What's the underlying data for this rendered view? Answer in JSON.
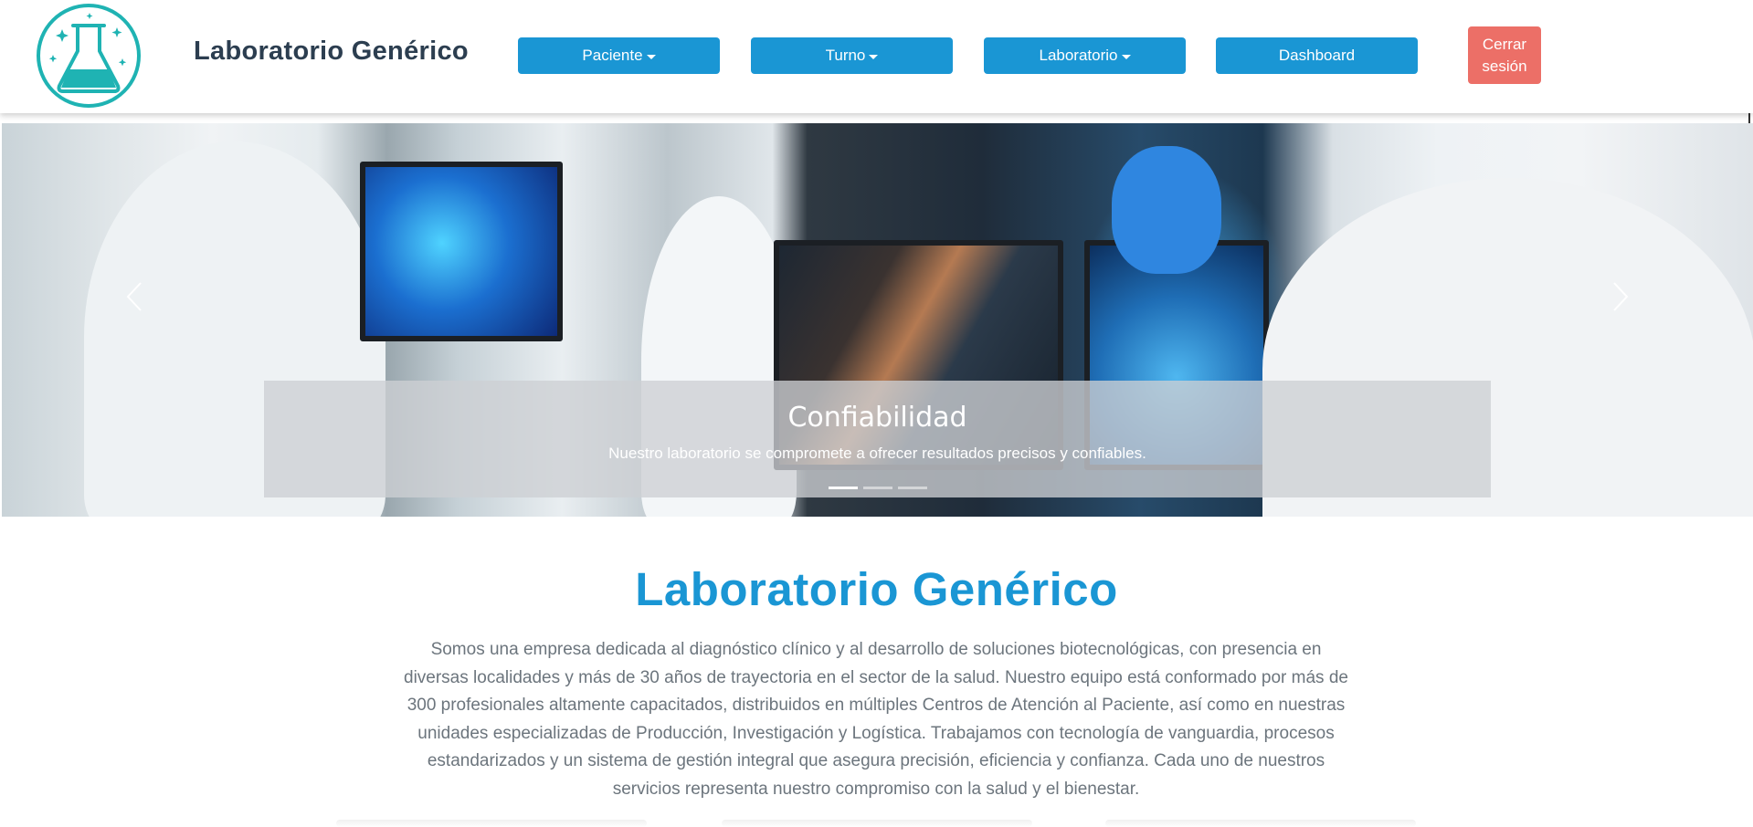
{
  "header": {
    "brand": "Laboratorio Genérico",
    "logo_icon": "flask-icon",
    "nav": {
      "paciente": "Paciente",
      "turno": "Turno",
      "laboratorio": "Laboratorio",
      "dashboard": "Dashboard"
    },
    "logout_label": "Cerrar sesión"
  },
  "carousel": {
    "caption_title": "Confiabilidad",
    "caption_text": "Nuestro laboratorio se compromete a ofrecer resultados precisos y confiables.",
    "prev_icon": "chevron-left-icon",
    "next_icon": "chevron-right-icon",
    "slide_count": 3,
    "active_slide": 1
  },
  "about": {
    "title": "Laboratorio Genérico",
    "text": "Somos una empresa dedicada al diagnóstico clínico y al desarrollo de soluciones biotecnológicas, con presencia en diversas localidades y más de 30 años de trayectoria en el sector de la salud. Nuestro equipo está conformado por más de 300 profesionales altamente capacitados, distribuidos en múltiples Centros de Atención al Paciente, así como en nuestras unidades especializadas de Producción, Investigación y Logística. Trabajamos con tecnología de vanguardia, procesos estandarizados y un sistema de gestión integral que asegura precisión, eficiencia y confianza. Cada uno de nuestros servicios representa nuestro compromiso con la salud y el bienestar."
  },
  "colors": {
    "primary": "#1a96d4",
    "danger": "#ec6f67",
    "brand_text": "#2c3e50",
    "logo_teal": "#1fb3b3"
  }
}
